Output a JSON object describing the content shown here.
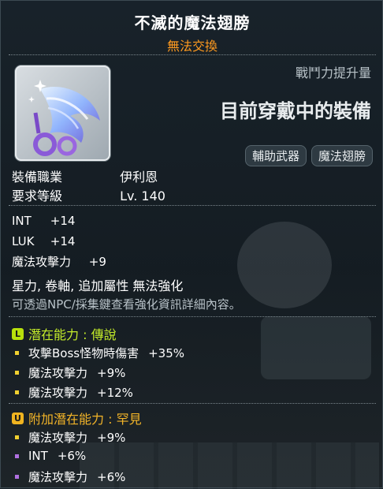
{
  "item": {
    "name": "不滅的魔法翅膀",
    "trade_status": "無法交換",
    "power_label": "戰鬥力提升量",
    "equipped_text": "目前穿戴中的裝備",
    "tags": [
      "輔助武器",
      "魔法翅膀"
    ],
    "job_label": "裝備職業",
    "job_value": "伊利恩",
    "level_label": "要求等級",
    "level_value": "Lv. 140"
  },
  "stats": [
    {
      "name": "INT",
      "value": "+14"
    },
    {
      "name": "LUK",
      "value": "+14"
    },
    {
      "name": "魔法攻擊力",
      "value": "+9"
    }
  ],
  "notes": {
    "line1": "星力, 卷軸, 追加屬性 無法強化",
    "line2": "可透過NPC/採集鍵查看強化資訊詳細內容。"
  },
  "potential": {
    "grade_letter": "L",
    "heading": "潛在能力 : 傳說",
    "lines": [
      {
        "name": "攻擊Boss怪物時傷害",
        "value": "+35%"
      },
      {
        "name": "魔法攻擊力",
        "value": "+9%"
      },
      {
        "name": "魔法攻擊力",
        "value": "+12%"
      }
    ]
  },
  "additional": {
    "grade_letter": "U",
    "heading": "附加潛在能力 : 罕見",
    "lines": [
      {
        "name": "魔法攻擊力",
        "value": "+9%"
      },
      {
        "name": "INT",
        "value": "+6%"
      },
      {
        "name": "魔法攻擊力",
        "value": "+6%"
      }
    ]
  },
  "colors": {
    "title": "#ffffff",
    "trade": "#ff9a1f",
    "legendary": "#c4ec2a",
    "unique": "#f2b428"
  },
  "icons": [
    "magic-wing-item-icon"
  ]
}
